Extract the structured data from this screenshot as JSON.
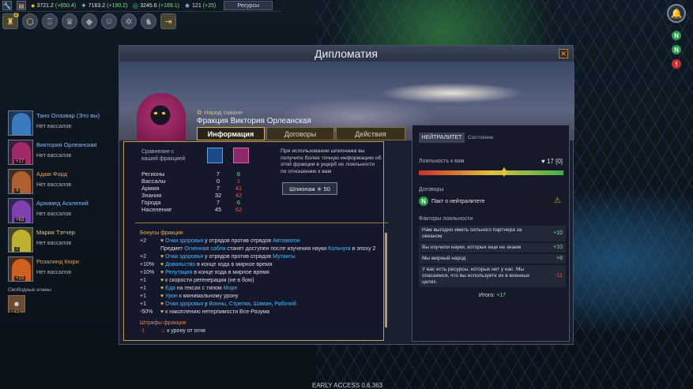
{
  "topbar": {
    "gold": "3721.2",
    "gold_plus": "(+650.4)",
    "mana": "7163.2",
    "mana_plus": "(+190.2)",
    "research": "3245.6",
    "research_plus": "(+169.1)",
    "influence": "121",
    "influence_plus": "(+25)",
    "resources_btn": "Ресурсы",
    "toolbar_badge": "2"
  },
  "leaders": [
    {
      "name": "Тано Олазвар (Это вы)",
      "sub": "Нет вассалов",
      "lvl": "",
      "color": "#3a7ac0",
      "name_color": "#8ab8ff"
    },
    {
      "name": "Виктория Орлеанская",
      "sub": "Нет вассалов",
      "lvl": "+17",
      "color": "#a02a6a",
      "name_color": "#8ab8ff"
    },
    {
      "name": "Адам Форд",
      "sub": "Нет вассалов",
      "lvl": "4",
      "color": "#b06030",
      "name_color": "#e0a060"
    },
    {
      "name": "Архимед Асклепий",
      "sub": "Нет вассалов",
      "lvl": "+63",
      "color": "#8040b0",
      "name_color": "#8ab8ff"
    },
    {
      "name": "Мария Тэтчер",
      "sub": "Нет вассалов",
      "lvl": "7",
      "color": "#c0b030",
      "name_color": "#e0d070"
    },
    {
      "name": "Розалинд Кюри",
      "sub": "Нет вассалов",
      "lvl": "+23",
      "color": "#d06020",
      "name_color": "#e0a060"
    }
  ],
  "free_clans": {
    "label": "Свободные кланы",
    "count": "+43"
  },
  "modal": {
    "title": "Дипломатия",
    "race": "Народ саванн",
    "faction_name": "Фракция Виктория Орлеанская",
    "tabs": [
      "Информация",
      "Договоры",
      "Действия"
    ],
    "compare_label": "Сравнение с вашей фракцией",
    "stats": [
      {
        "k": "Регионы",
        "a": "7",
        "b": "6",
        "c": "pos"
      },
      {
        "k": "Вассалы",
        "a": "0",
        "b": "1",
        "c": "neg"
      },
      {
        "k": "Армия",
        "a": "7",
        "b": "41",
        "c": "neg"
      },
      {
        "k": "Знания",
        "a": "32",
        "b": "42",
        "c": "neg"
      },
      {
        "k": "Города",
        "a": "7",
        "b": "6",
        "c": "pos"
      },
      {
        "k": "Население",
        "a": "45",
        "b": "62",
        "c": "neg"
      }
    ],
    "spy_text": "При использовании шпионажа вы получите более точную информацию об этой фракции в ущерб их лояльности по отношению к вам",
    "spy_button": "Шпионаж",
    "spy_cost": "50",
    "bonus_header": "Бонусы фракции",
    "penalty_header": "Штрафы фракции",
    "penalty_first": "к урону от огня",
    "bonus_lines": [
      {
        "n": "+2",
        "parts": [
          {
            "t": "Очки здоровья",
            "h": true
          },
          {
            "t": " у отрядов против отрядов ",
            "h": false
          },
          {
            "t": "Автоматон",
            "h": true
          }
        ]
      },
      {
        "n": "",
        "parts": [
          {
            "t": "Предмет ",
            "h": false
          },
          {
            "t": "Огненная сабля",
            "h": true
          },
          {
            "t": " станет доступен после изучения науки ",
            "h": false
          },
          {
            "t": "Кольчуга",
            "h": true
          },
          {
            "t": " в эпоху 2",
            "h": false
          }
        ]
      },
      {
        "n": "+2",
        "parts": [
          {
            "t": "Очки здоровья",
            "h": true
          },
          {
            "t": " у отрядов против отрядов ",
            "h": false
          },
          {
            "t": "Мутанты",
            "h": true
          }
        ]
      },
      {
        "n": "+10%",
        "parts": [
          {
            "t": "Довольство",
            "h": true
          },
          {
            "t": " в конце хода в мирное время",
            "h": false
          }
        ]
      },
      {
        "n": "+10%",
        "parts": [
          {
            "t": "Репутация",
            "h": true
          },
          {
            "t": " в конце хода в мирное время",
            "h": false
          }
        ]
      },
      {
        "n": "+1",
        "parts": [
          {
            "t": "к скорости регенерации (не в бою)",
            "h": false
          }
        ]
      },
      {
        "n": "+1",
        "parts": [
          {
            "t": "Еда",
            "h": true
          },
          {
            "t": " на гексах с типом ",
            "h": false
          },
          {
            "t": "Море",
            "h": true
          }
        ]
      },
      {
        "n": "+1",
        "parts": [
          {
            "t": "Урон",
            "h": true
          },
          {
            "t": " к минимальному урону",
            "h": false
          }
        ]
      },
      {
        "n": "+1",
        "parts": [
          {
            "t": "Очки здоровья",
            "h": true
          },
          {
            "t": " у ",
            "h": false
          },
          {
            "t": "Воины",
            "h": true
          },
          {
            "t": ", ",
            "h": false
          },
          {
            "t": "Стрелки",
            "h": true
          },
          {
            "t": ", ",
            "h": false
          },
          {
            "t": "Шаман",
            "h": true
          },
          {
            "t": ", ",
            "h": false
          },
          {
            "t": "Рабочий",
            "h": true
          }
        ]
      },
      {
        "n": "-50%",
        "parts": [
          {
            "t": "к накоплению нетерпимости Все-Разума",
            "h": false
          }
        ]
      }
    ],
    "right": {
      "neutral": "НЕЙТРАЛИТЕТ",
      "state": "Состояние",
      "loyalty_label": "Лояльность к вам",
      "loyalty_value": "17 [0]",
      "loyalty_level": 0.59,
      "treaties_label": "Договоры",
      "treaty": "Пакт о нейтралитете",
      "factors_label": "Факторы лояльности",
      "factors": [
        {
          "t": "Нам выгодно иметь сильного партнера за океаном",
          "v": "+10",
          "c": "pos"
        },
        {
          "t": "Вы изучили науки, которых еще не знаем",
          "v": "+10",
          "c": "pos"
        },
        {
          "t": "Мы мирный народ",
          "v": "+8",
          "c": "pos"
        },
        {
          "t": "У вас есть ресурсы, которых нет у нас. Мы опасаемся, что вы используете их в военных целях.",
          "v": "-11",
          "c": "neg"
        }
      ],
      "total_label": "Итого:",
      "total_value": "+17"
    }
  },
  "footer": "EARLY ACCESS 0.6.363"
}
